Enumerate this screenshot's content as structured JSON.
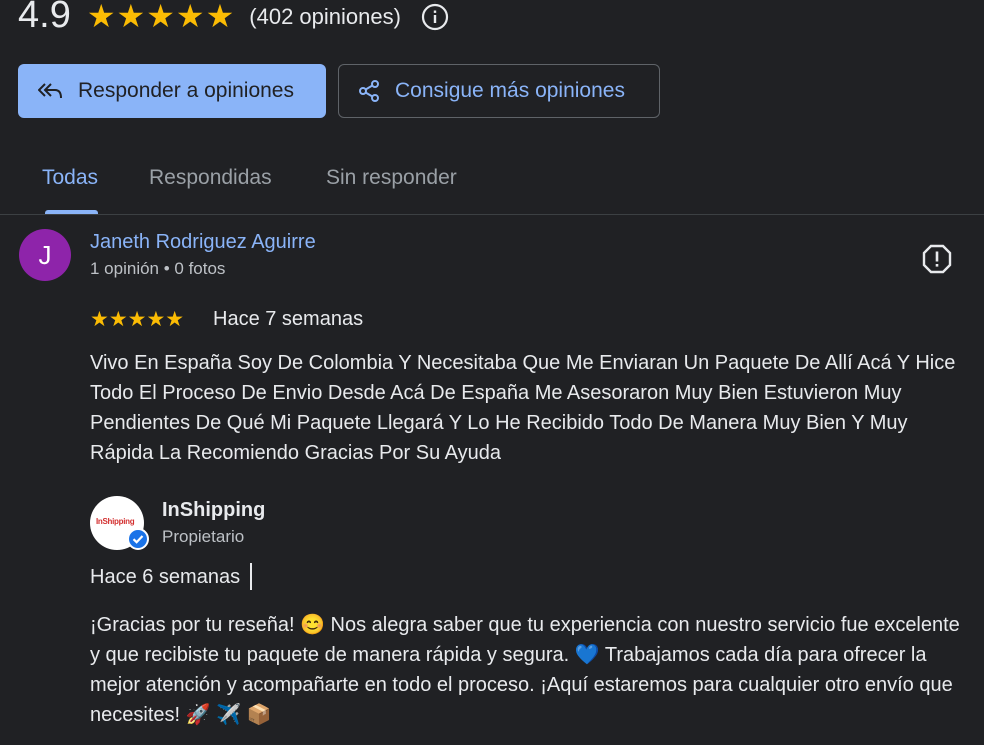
{
  "summary": {
    "rating": "4.9",
    "stars": "★★★★★",
    "count": "(402 opiniones)"
  },
  "actions": {
    "reply_label": "Responder a opiniones",
    "more_label": "Consigue más opiniones"
  },
  "tabs": [
    {
      "label": "Todas",
      "active": true
    },
    {
      "label": "Respondidas",
      "active": false
    },
    {
      "label": "Sin responder",
      "active": false
    }
  ],
  "review": {
    "avatar_letter": "J",
    "avatar_color": "#8e24aa",
    "author": "Janeth Rodriguez Aguirre",
    "meta": "1 opinión • 0 fotos",
    "stars": "★★★★★",
    "time": "Hace 7 semanas",
    "text": "Vivo En España Soy De Colombia Y Necesitaba Que Me Enviaran Un Paquete De Allí Acá Y Hice Todo El Proceso De Envio Desde Acá De España Me Asesoraron Muy Bien Estuvieron Muy Pendientes De Qué Mi Paquete Llegará Y Lo He Recibido Todo De Manera Muy Bien Y Muy Rápida La Recomiendo Gracias Por Su Ayuda"
  },
  "reply": {
    "logo_text": "InShipping",
    "name": "InShipping",
    "role": "Propietario",
    "time": "Hace 6 semanas",
    "text": "¡Gracias por tu reseña! 😊 Nos alegra saber que tu experiencia con nuestro servicio fue excelente y que recibiste tu paquete de manera rápida y segura. 💙 Trabajamos cada día para ofrecer la mejor atención y acompañarte en todo el proceso. ¡Aquí estaremos para cualquier otro envío que necesites! 🚀 ✈️ 📦"
  },
  "colors": {
    "background": "#202124",
    "accent": "#8ab4f8",
    "star": "#fbbc04"
  },
  "icons": [
    "info-icon",
    "reply-all-icon",
    "share-icon",
    "report-flag-icon",
    "verified-badge-icon"
  ]
}
